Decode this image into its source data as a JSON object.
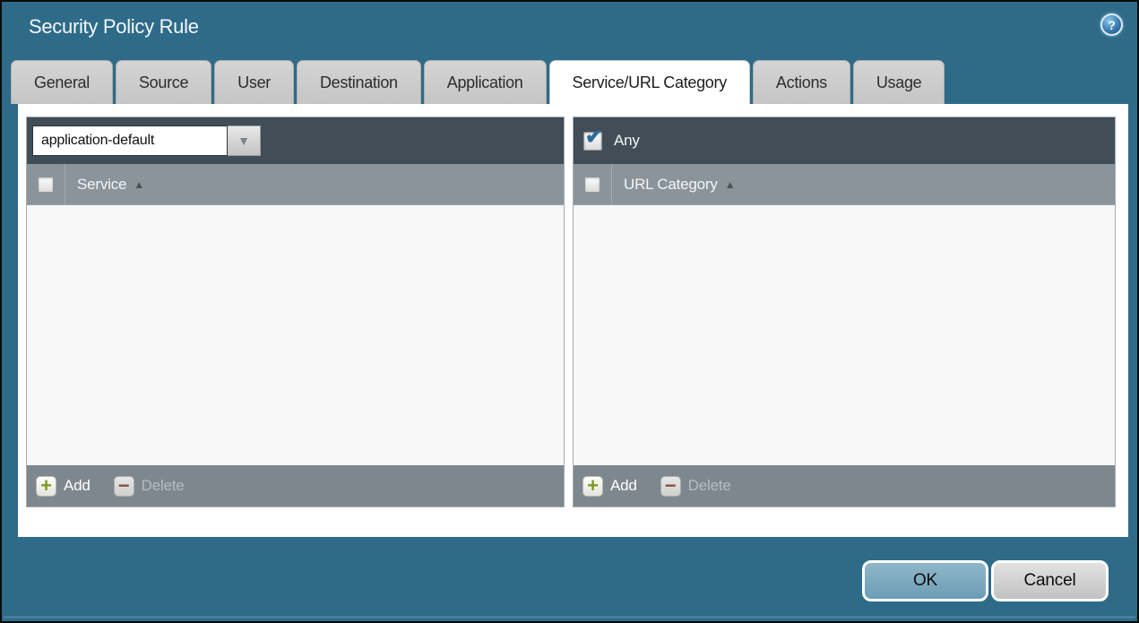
{
  "dialog": {
    "title": "Security Policy Rule",
    "ok_label": "OK",
    "cancel_label": "Cancel"
  },
  "icons": {
    "help_glyph": "?",
    "dropdown_arrow_glyph": "▼",
    "sort_asc_glyph": "▲",
    "check_glyph": "✔",
    "plus_glyph": "+",
    "minus_glyph": "−"
  },
  "tabs": [
    {
      "label": "General",
      "active": false
    },
    {
      "label": "Source",
      "active": false
    },
    {
      "label": "User",
      "active": false
    },
    {
      "label": "Destination",
      "active": false
    },
    {
      "label": "Application",
      "active": false
    },
    {
      "label": "Service/URL Category",
      "active": true
    },
    {
      "label": "Actions",
      "active": false
    },
    {
      "label": "Usage",
      "active": false
    }
  ],
  "service_panel": {
    "dropdown_value": "application-default",
    "column_header": "Service",
    "select_all_checked": false,
    "rows": [],
    "add_label": "Add",
    "delete_label": "Delete",
    "delete_enabled": false
  },
  "url_panel": {
    "any_label": "Any",
    "any_checked": true,
    "column_header": "URL Category",
    "select_all_checked": false,
    "rows": [],
    "add_label": "Add",
    "delete_label": "Delete",
    "delete_enabled": false
  },
  "colors": {
    "dialog_background": "#2e6b89",
    "panel_header_dark": "#414e57",
    "column_header_gray": "#8b949b",
    "panel_footer_gray": "#7e878e",
    "tab_inactive": "#cbcbcb",
    "tab_active": "#ffffff",
    "ok_button_fill": "#6f9fb5",
    "cancel_button_fill": "#cccccc",
    "add_plus_green": "#7a9b1d",
    "delete_minus_red": "#8a4136",
    "checkbox_check_blue": "#2a6d96",
    "help_icon_blue": "#3a7cb0"
  }
}
